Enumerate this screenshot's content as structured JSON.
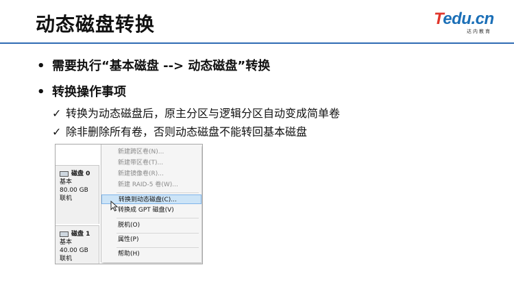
{
  "slide": {
    "title": "动态磁盘转换",
    "bullets": [
      {
        "label": "需要执行“基本磁盘 --> 动态磁盘”转换"
      },
      {
        "label": "转换操作事项"
      }
    ],
    "checks": [
      {
        "label": "转换为动态磁盘后，原主分区与逻辑分区自动变成简单卷"
      },
      {
        "label": "除非删除所有卷，否则动态磁盘不能转回基本磁盘"
      }
    ]
  },
  "logo": {
    "brand_t": "T",
    "brand_rest": "edu.cn",
    "tagline": "达内教育"
  },
  "bullet_glyph": "•",
  "check_glyph": "✓",
  "screenshot": {
    "disks": [
      {
        "name": "磁盘 0",
        "type": "基本",
        "size": "80.00 GB",
        "status": "联机"
      },
      {
        "name": "磁盘 1",
        "type": "基本",
        "size": "40.00 GB",
        "status": "联机"
      }
    ],
    "menu": [
      {
        "label": "新建跨区卷(N)...",
        "disabled": true
      },
      {
        "label": "新建带区卷(T)...",
        "disabled": true
      },
      {
        "label": "新建镜像卷(R)...",
        "disabled": true
      },
      {
        "label": "新建 RAID-5 卷(W)...",
        "disabled": true
      },
      {
        "label": "转换到动态磁盘(C)...",
        "highlighted": true
      },
      {
        "label": "转换成 GPT 磁盘(V)"
      },
      {
        "label": "脱机(O)"
      },
      {
        "label": "属性(P)"
      },
      {
        "label": "帮助(H)"
      }
    ]
  },
  "colors": {
    "title_rule": "#2d6ab3",
    "logo_red": "#e0352b",
    "logo_blue": "#1b6fb7",
    "menu_highlight": "#cce4f7"
  }
}
